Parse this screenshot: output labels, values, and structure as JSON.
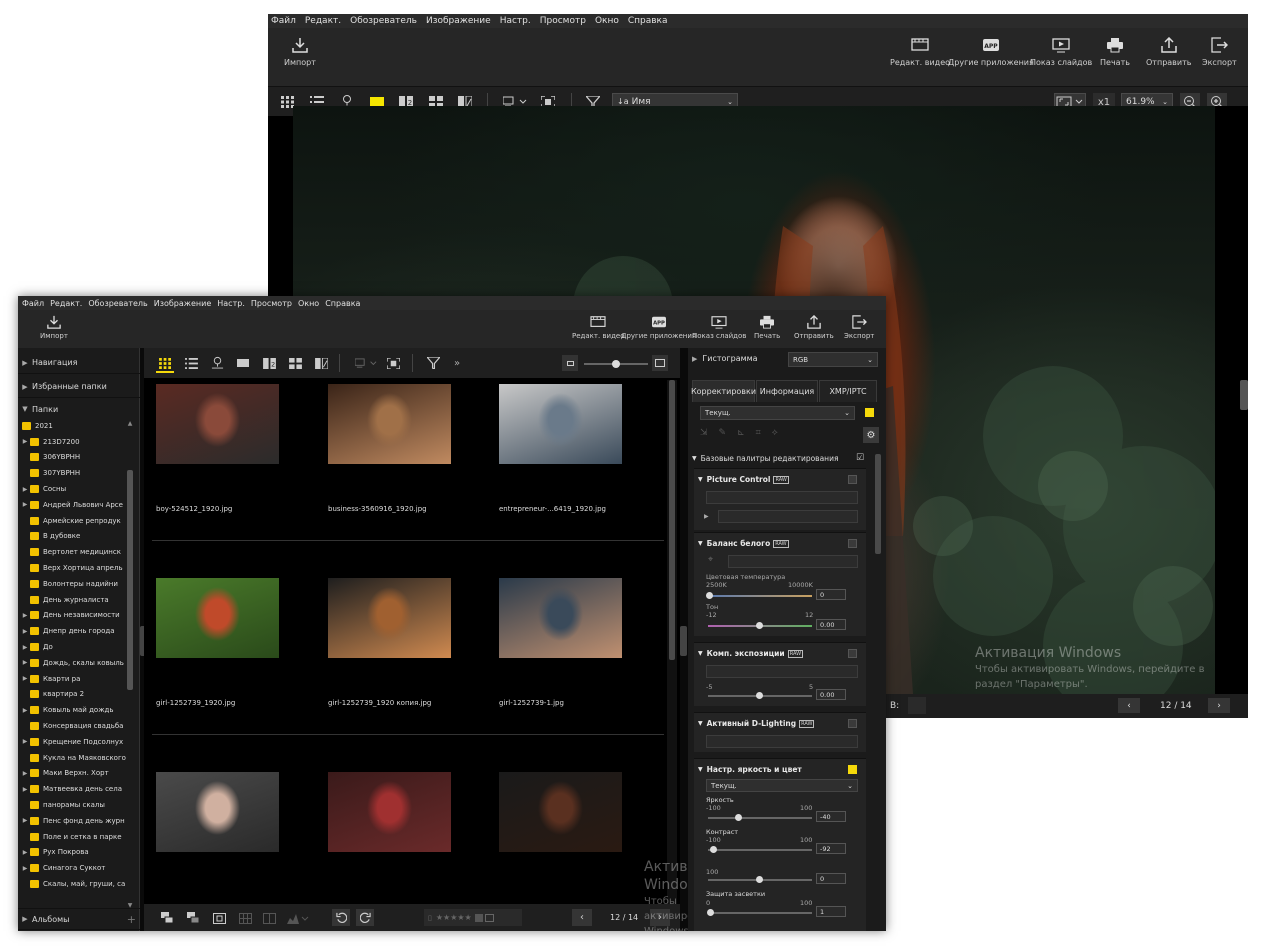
{
  "menu": [
    "Файл",
    "Редакт.",
    "Обозреватель",
    "Изображение",
    "Настр.",
    "Просмотр",
    "Окно",
    "Справка"
  ],
  "toolbar": {
    "import": "Импорт",
    "edit_video": "Редакт. видео",
    "other_apps": "Другие приложения",
    "slideshow": "Показ слайдов",
    "print": "Печать",
    "send": "Отправить",
    "export": "Экспорт"
  },
  "viewer": {
    "sort_label": "Имя",
    "zoom_x1": "x1",
    "zoom_value": "61.9%",
    "status_b": "B:",
    "page_counter": "12 / 14"
  },
  "watermark": {
    "title": "Активация Windows",
    "line1": "Чтобы активировать Windows, перейдите в",
    "line2": "раздел \"Параметры\"."
  },
  "left_panel": {
    "navigation": "Навигация",
    "favorites": "Избранные папки",
    "folders": "Папки",
    "albums": "Альбомы",
    "folder_items": [
      {
        "name": "2021",
        "expand": false,
        "indent": 0
      },
      {
        "name": "213D7200",
        "expand": true,
        "indent": 1
      },
      {
        "name": "306YBPHH",
        "expand": false,
        "indent": 1
      },
      {
        "name": "307YBPHH",
        "expand": false,
        "indent": 1
      },
      {
        "name": "Сосны",
        "expand": true,
        "indent": 1
      },
      {
        "name": "Андрей Львович Арсе",
        "expand": true,
        "indent": 1
      },
      {
        "name": "Армейские репродук",
        "expand": false,
        "indent": 1
      },
      {
        "name": "В дубовке",
        "expand": false,
        "indent": 1
      },
      {
        "name": "Вертолет медицинск",
        "expand": false,
        "indent": 1
      },
      {
        "name": "Верх Хортица апрель",
        "expand": false,
        "indent": 1
      },
      {
        "name": "Волонтеры надийни",
        "expand": false,
        "indent": 1
      },
      {
        "name": "День журналиста",
        "expand": false,
        "indent": 1
      },
      {
        "name": "День независимости",
        "expand": true,
        "indent": 1
      },
      {
        "name": "Днепр день города",
        "expand": true,
        "indent": 1
      },
      {
        "name": "До",
        "expand": true,
        "indent": 1
      },
      {
        "name": "Дождь, скалы ковыль",
        "expand": true,
        "indent": 1
      },
      {
        "name": "Кварти ра",
        "expand": true,
        "indent": 1
      },
      {
        "name": "квартира 2",
        "expand": false,
        "indent": 1
      },
      {
        "name": "Ковыль май дождь",
        "expand": true,
        "indent": 1
      },
      {
        "name": "Консервация свадьба",
        "expand": false,
        "indent": 1
      },
      {
        "name": "Крещение Подсолнух",
        "expand": true,
        "indent": 1
      },
      {
        "name": "Кукла на Маяковского",
        "expand": false,
        "indent": 1
      },
      {
        "name": "Маки Верхн. Хорт",
        "expand": true,
        "indent": 1
      },
      {
        "name": "Матвеевка день села",
        "expand": true,
        "indent": 1
      },
      {
        "name": "панорамы скалы",
        "expand": false,
        "indent": 1
      },
      {
        "name": "Пенс фонд день журн",
        "expand": true,
        "indent": 1
      },
      {
        "name": "Поле и сетка в парке",
        "expand": false,
        "indent": 1
      },
      {
        "name": "Рух Покрова",
        "expand": true,
        "indent": 1
      },
      {
        "name": "Синагога Суккот",
        "expand": true,
        "indent": 1
      },
      {
        "name": "Скалы, май, груши, са",
        "expand": false,
        "indent": 1
      }
    ]
  },
  "thumbnails": [
    {
      "name": "boy-524512_1920.jpg"
    },
    {
      "name": "business-3560916_1920.jpg"
    },
    {
      "name": "entrepreneur-...6419_1920.jpg"
    },
    {
      "name": "girl-1252739_1920.jpg"
    },
    {
      "name": "girl-1252739_1920 копия.jpg"
    },
    {
      "name": "girl-1252739-1.jpg"
    },
    {
      "name": ""
    },
    {
      "name": ""
    },
    {
      "name": ""
    }
  ],
  "center_bottom": {
    "page_counter": "12 / 14"
  },
  "right_panel": {
    "histogram": "Гистограмма",
    "histogram_mode": "RGB",
    "tabs": [
      "Корректировки",
      "Информация",
      "XMP/IPTC"
    ],
    "preset": "Текущ.",
    "basic_palettes": "Базовые палитры редактирования",
    "picture_control": "Picture Control",
    "white_balance": "Баланс белого",
    "color_temp": "Цветовая температура",
    "temp_min": "2500K",
    "temp_max": "10000K",
    "temp_value": "0",
    "tone": "Тон",
    "tone_min": "-12",
    "tone_max": "12",
    "tone_value": "0.00",
    "exposure_comp": "Комп. экспозиции",
    "exp_min": "-5",
    "exp_max": "5",
    "exp_value": "0.00",
    "adl": "Активный D-Lighting",
    "brightness_color": "Настр. яркость и цвет",
    "bc_preset": "Текущ.",
    "brightness": "Яркость",
    "br_min": "-100",
    "br_max": "100",
    "br_value": "-40",
    "contrast": "Контраст",
    "ct_min": "-100",
    "ct_max": "100",
    "ct_value": "-92",
    "saturation_min": "100",
    "saturation_value": "0",
    "highlight_protection": "Защита засветки",
    "hp_min": "0",
    "hp_max": "100",
    "hp_value": "1"
  },
  "colors": {
    "accent": "#f5d90a",
    "folder": "#f2c200"
  }
}
